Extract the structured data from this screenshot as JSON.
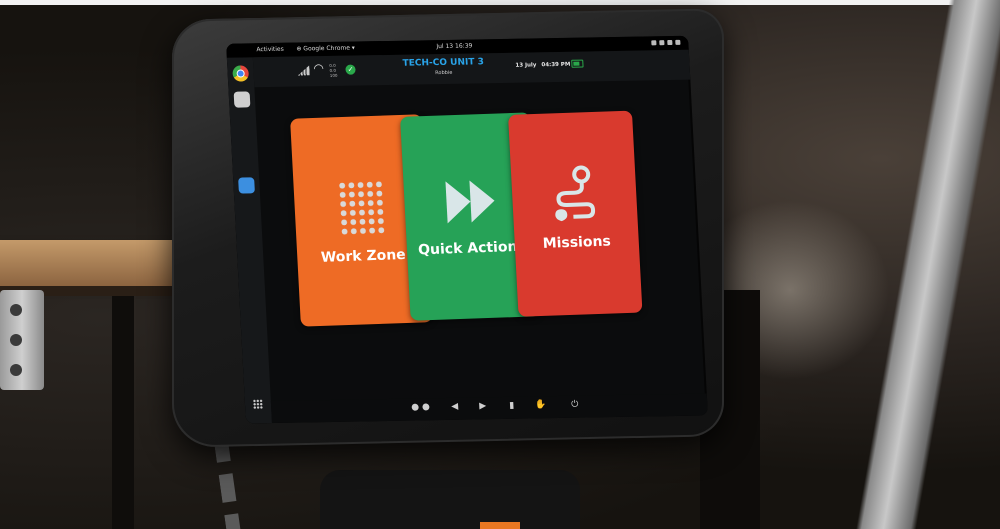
{
  "system_bar": {
    "activities": "Activities",
    "app_menu": "⊕ Google Chrome ▾",
    "clock": "Jul 13 16:39"
  },
  "header": {
    "unit_title": "TECH-CO UNIT 3",
    "user": "Robbie",
    "date": "13 July",
    "time": "04:39 PM",
    "wifi_stats": [
      "0.0",
      "0.0",
      "100"
    ],
    "battery_color": "#2aa84a"
  },
  "tiles": [
    {
      "label": "Work Zone",
      "color": "#ee6b25",
      "icon": "grid-icon"
    },
    {
      "label": "Quick Actions",
      "color": "#26a257",
      "icon": "fast-forward-icon"
    },
    {
      "label": "Missions",
      "color": "#d93a2e",
      "icon": "route-icon"
    }
  ],
  "nav_bar": {
    "dots": "● ●",
    "back": "◀",
    "forward": "▶",
    "stop": "▮",
    "hand": "✋",
    "power": "⏻"
  },
  "colors": {
    "accent_blue": "#29a3e8",
    "ok_green": "#2aa84a"
  }
}
